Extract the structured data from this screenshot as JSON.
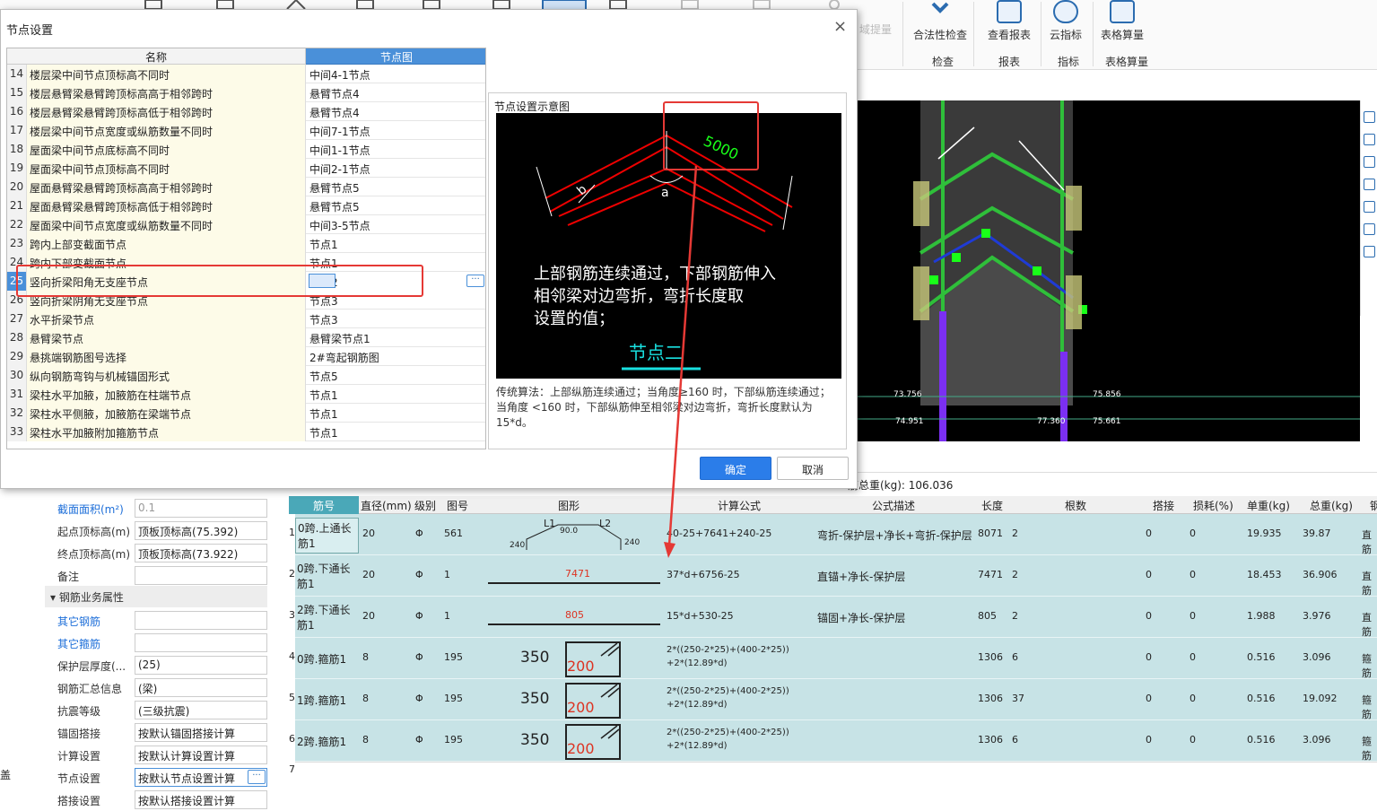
{
  "ribbon": {
    "buttons": [
      {
        "label": "合法性检查",
        "icon": "check-icon"
      },
      {
        "label": "查看报表",
        "icon": "report-icon"
      },
      {
        "label": "云指标",
        "icon": "cloud-icon"
      },
      {
        "label": "表格算量",
        "icon": "table-icon"
      }
    ],
    "faded_label": "域提量",
    "groups": [
      "检查",
      "报表",
      "指标",
      "表格算量"
    ]
  },
  "dialog": {
    "title": "节点设置",
    "close_label": "×",
    "columns": [
      "名称",
      "节点图"
    ],
    "rows": [
      {
        "n": "14",
        "name": "楼层梁中间节点顶标高不同时",
        "value": "中间4-1节点"
      },
      {
        "n": "15",
        "name": "楼层悬臂梁悬臂跨顶标高高于相邻跨时",
        "value": "悬臂节点4"
      },
      {
        "n": "16",
        "name": "楼层悬臂梁悬臂跨顶标高低于相邻跨时",
        "value": "悬臂节点4"
      },
      {
        "n": "17",
        "name": "楼层梁中间节点宽度或纵筋数量不同时",
        "value": "中间7-1节点"
      },
      {
        "n": "18",
        "name": "屋面梁中间节点底标高不同时",
        "value": "中间1-1节点"
      },
      {
        "n": "19",
        "name": "屋面梁中间节点顶标高不同时",
        "value": "中间2-1节点"
      },
      {
        "n": "20",
        "name": "屋面悬臂梁悬臂跨顶标高高于相邻跨时",
        "value": "悬臂节点5"
      },
      {
        "n": "21",
        "name": "屋面悬臂梁悬臂跨顶标高低于相邻跨时",
        "value": "悬臂节点5"
      },
      {
        "n": "22",
        "name": "屋面梁中间节点宽度或纵筋数量不同时",
        "value": "中间3-5节点"
      },
      {
        "n": "23",
        "name": "跨内上部变截面节点",
        "value": "节点1"
      },
      {
        "n": "24",
        "name": "跨内下部变截面节点",
        "value": "节点1"
      },
      {
        "n": "25",
        "name": "竖向折梁阳角无支座节点",
        "value": "节点2"
      },
      {
        "n": "26",
        "name": "竖向折梁阴角无支座节点",
        "value": "节点3"
      },
      {
        "n": "27",
        "name": "水平折梁节点",
        "value": "节点3"
      },
      {
        "n": "28",
        "name": "悬臂梁节点",
        "value": "悬臂梁节点1"
      },
      {
        "n": "29",
        "name": "悬挑端钢筋图号选择",
        "value": "2#弯起钢筋图"
      },
      {
        "n": "30",
        "name": "纵向钢筋弯钩与机械锚固形式",
        "value": "节点5"
      },
      {
        "n": "31",
        "name": "梁柱水平加腋，加腋筋在柱端节点",
        "value": "节点1"
      },
      {
        "n": "32",
        "name": "梁柱水平侧腋，加腋筋在梁端节点",
        "value": "节点1"
      },
      {
        "n": "33",
        "name": "梁柱水平加腋附加箍筋节点",
        "value": "节点1"
      }
    ],
    "selected_row_label": "25",
    "selected_value": "节点2",
    "more_label": "···",
    "preview": {
      "title": "节点设置示意图",
      "dim_label": "5000",
      "b_label": "b",
      "angle_label": "a",
      "img_line1": "上部钢筋连续通过，下部钢筋伸入",
      "img_line2": "相邻梁对边弯折，弯折长度取",
      "img_line3": "设置的值；",
      "img_caption": "节点二",
      "desc": "传统算法：上部纵筋连续通过；当角度≥160 时，下部纵筋连续通过；当角度 <160 时，下部纵筋伸至相邻梁对边弯折，弯折长度默认为15*d。"
    },
    "ok_label": "确定",
    "cancel_label": "取消"
  },
  "viewport": {
    "dims": [
      "73.756",
      "74.951",
      "77.360",
      "75.856",
      "75.661"
    ],
    "colors": {
      "bg": "#000000",
      "green": "#2fbf3a",
      "purple": "#7b2ff2",
      "blue": "#1f3bd6",
      "yellow": "#c8c87a"
    }
  },
  "summary": {
    "label": "筋总重(kg): 106.036"
  },
  "props": {
    "rows": [
      {
        "label": "截面面积(m²)",
        "value": "0.1",
        "link": true,
        "grey": true
      },
      {
        "label": "起点顶标高(m)",
        "value": "顶板顶标高(75.392)"
      },
      {
        "label": "终点顶标高(m)",
        "value": "顶板顶标高(73.922)"
      },
      {
        "label": "备注",
        "value": ""
      },
      {
        "label": "其它钢筋",
        "value": "",
        "link": true
      },
      {
        "label": "其它箍筋",
        "value": "",
        "link": true
      },
      {
        "label": "保护层厚度(...",
        "value": "(25)"
      },
      {
        "label": "钢筋汇总信息",
        "value": "(梁)"
      },
      {
        "label": "抗震等级",
        "value": "(三级抗震)"
      },
      {
        "label": "锚固搭接",
        "value": "按默认锚固搭接计算"
      },
      {
        "label": "计算设置",
        "value": "按默认计算设置计算"
      },
      {
        "label": "节点设置",
        "value": "按默认节点设置计算"
      },
      {
        "label": "搭接设置",
        "value": "按默认搭接设置计算"
      }
    ],
    "section": "钢筋业务属性",
    "side_label": "盖"
  },
  "table": {
    "headers": [
      "筋号",
      "直径(mm)",
      "级别",
      "图号",
      "图形",
      "计算公式",
      "公式描述",
      "长度",
      "根数",
      "搭接",
      "损耗(%)",
      "单重(kg)",
      "总重(kg)",
      "钢"
    ],
    "rows": [
      {
        "n": "1",
        "name": "0跨.上通长筋1",
        "dia": "20",
        "grade": "Φ",
        "fig": "561",
        "shape_main": "90.0",
        "shape_l1": "L1",
        "shape_l2": "L2",
        "shape_a": "240",
        "shape_b": "240",
        "formula": "40-25+7641+240-25",
        "desc": "弯折-保护层+净长+弯折-保护层",
        "len": "8071",
        "count": "2",
        "lap": "0",
        "loss": "0",
        "unit": "19.935",
        "total": "39.87",
        "tail": "直筋"
      },
      {
        "n": "2",
        "name": "0跨.下通长筋1",
        "dia": "20",
        "grade": "Φ",
        "fig": "1",
        "shape_main": "7471",
        "formula": "37*d+6756-25",
        "desc": "直锚+净长-保护层",
        "len": "7471",
        "count": "2",
        "lap": "0",
        "loss": "0",
        "unit": "18.453",
        "total": "36.906",
        "tail": "直筋"
      },
      {
        "n": "3",
        "name": "2跨.下通长筋1",
        "dia": "20",
        "grade": "Φ",
        "fig": "1",
        "shape_main": "805",
        "formula": "15*d+530-25",
        "desc": "锚固+净长-保护层",
        "len": "805",
        "count": "2",
        "lap": "0",
        "loss": "0",
        "unit": "1.988",
        "total": "3.976",
        "tail": "直筋"
      },
      {
        "n": "4",
        "name": "0跨.箍筋1",
        "dia": "8",
        "grade": "Φ",
        "fig": "195",
        "shape_a": "350",
        "shape_b": "200",
        "formula1": "2*((250-2*25)+(400-2*25))",
        "formula2": "+2*(12.89*d)",
        "desc": "",
        "len": "1306",
        "count": "6",
        "lap": "0",
        "loss": "0",
        "unit": "0.516",
        "total": "3.096",
        "tail": "箍筋"
      },
      {
        "n": "5",
        "name": "1跨.箍筋1",
        "dia": "8",
        "grade": "Φ",
        "fig": "195",
        "shape_a": "350",
        "shape_b": "200",
        "formula1": "2*((250-2*25)+(400-2*25))",
        "formula2": "+2*(12.89*d)",
        "desc": "",
        "len": "1306",
        "count": "37",
        "lap": "0",
        "loss": "0",
        "unit": "0.516",
        "total": "19.092",
        "tail": "箍筋"
      },
      {
        "n": "6",
        "name": "2跨.箍筋1",
        "dia": "8",
        "grade": "Φ",
        "fig": "195",
        "shape_a": "350",
        "shape_b": "200",
        "formula1": "2*((250-2*25)+(400-2*25))",
        "formula2": "+2*(12.89*d)",
        "desc": "",
        "len": "1306",
        "count": "6",
        "lap": "0",
        "loss": "0",
        "unit": "0.516",
        "total": "3.096",
        "tail": "箍筋"
      }
    ],
    "empty_row_label": "7"
  },
  "accent": "#4a90d9",
  "highlight": "#e53935"
}
